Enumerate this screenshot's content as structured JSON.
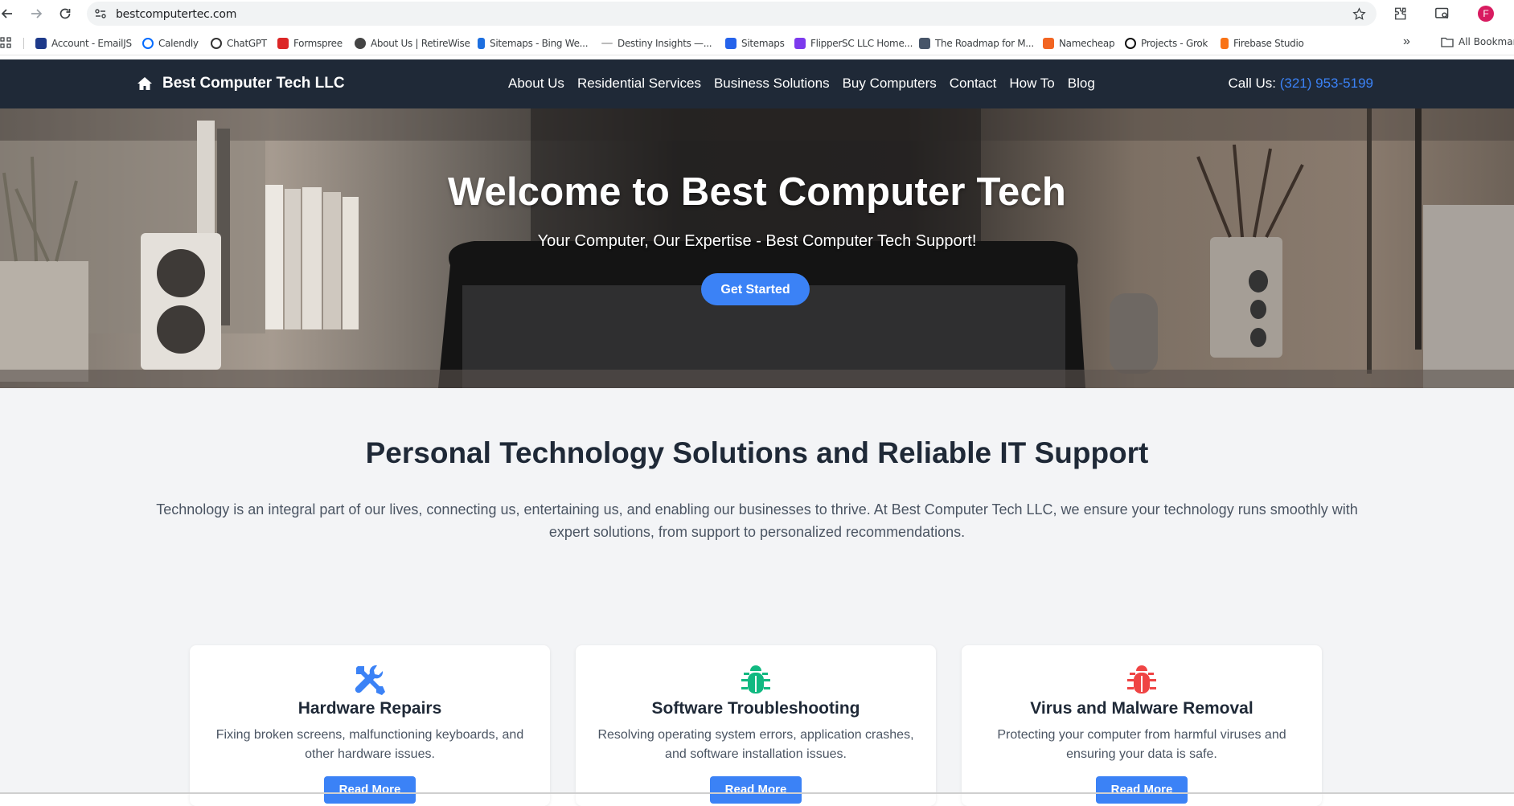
{
  "browser": {
    "url": "bestcomputertec.com",
    "profile_initial": "F"
  },
  "bookmarks": {
    "items": [
      {
        "label": "Account - EmailJS",
        "color": "#1e3a8a"
      },
      {
        "label": "Calendly",
        "color": "#006bff"
      },
      {
        "label": "ChatGPT",
        "color": "#333333"
      },
      {
        "label": "Formspree",
        "color": "#dc2626"
      },
      {
        "label": "About Us | RetireWise",
        "color": "#444444"
      },
      {
        "label": "Sitemaps - Bing We...",
        "color": "#1d6fe0"
      },
      {
        "label": "Destiny Insights —...",
        "color": "#bbbbbb"
      },
      {
        "label": "Sitemaps",
        "color": "#2563eb"
      },
      {
        "label": "FlipperSC LLC Home...",
        "color": "#7c3aed"
      },
      {
        "label": "The Roadmap for M...",
        "color": "#475569"
      },
      {
        "label": "Namecheap",
        "color": "#f26522"
      },
      {
        "label": "Projects - Grok",
        "color": "#111111"
      },
      {
        "label": "Firebase Studio",
        "color": "#f97316"
      }
    ],
    "more": "»",
    "all_bookmarks": "All Bookmarks"
  },
  "nav": {
    "brand": "Best Computer Tech LLC",
    "links": [
      "About Us",
      "Residential Services",
      "Business Solutions",
      "Buy Computers",
      "Contact",
      "How To",
      "Blog"
    ],
    "call_label": "Call Us:",
    "phone": "(321) 953-5199"
  },
  "hero": {
    "title": "Welcome to Best Computer Tech",
    "subtitle": "Your Computer, Our Expertise - Best Computer Tech Support!",
    "cta": "Get Started"
  },
  "intro": {
    "title": "Personal Technology Solutions and Reliable IT Support",
    "body": "Technology is an integral part of our lives, connecting us, entertaining us, and enabling our businesses to thrive. At Best Computer Tech LLC, we ensure your technology runs smoothly with expert solutions, from support to personalized recommendations."
  },
  "cards": [
    {
      "title": "Hardware Repairs",
      "desc": "Fixing broken screens, malfunctioning keyboards, and other hardware issues.",
      "button": "Read More",
      "icon": "tools-icon",
      "color": "#3b82f6"
    },
    {
      "title": "Software Troubleshooting",
      "desc": "Resolving operating system errors, application crashes, and software installation issues.",
      "button": "Read More",
      "icon": "bug-icon",
      "color": "#10b981"
    },
    {
      "title": "Virus and Malware Removal",
      "desc": "Protecting your computer from harmful viruses and ensuring your data is safe.",
      "button": "Read More",
      "icon": "bug-icon",
      "color": "#ef4444"
    }
  ]
}
